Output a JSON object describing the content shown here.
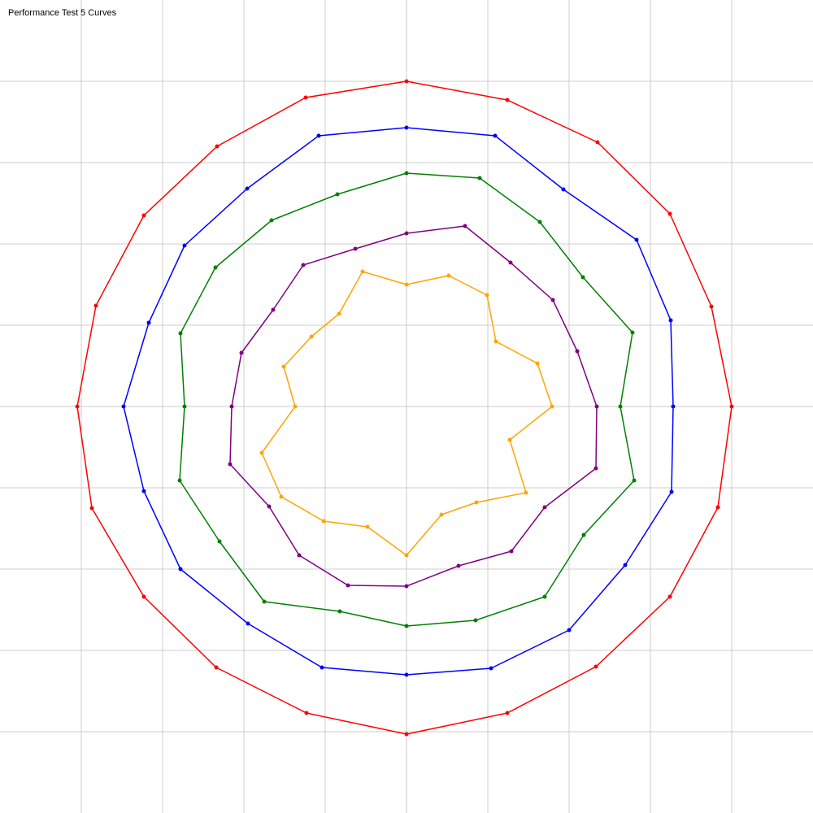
{
  "chart_data": {
    "type": "line",
    "title": "Performance Test 5 Curves",
    "grid": true,
    "xlim": [
      -5,
      5
    ],
    "ylim": [
      -5,
      5
    ],
    "series": [
      {
        "color": "#ff0000",
        "points": [
          [
            0,
            4
          ],
          [
            1.24,
            3.77
          ],
          [
            2.35,
            3.25
          ],
          [
            3.24,
            2.37
          ],
          [
            3.75,
            1.23
          ],
          [
            4,
            0
          ],
          [
            3.83,
            -1.24
          ],
          [
            3.24,
            -2.34
          ],
          [
            2.33,
            -3.2
          ],
          [
            1.24,
            -3.77
          ],
          [
            0,
            -4.03
          ],
          [
            -1.23,
            -3.77
          ],
          [
            -2.34,
            -3.21
          ],
          [
            -3.23,
            -2.34
          ],
          [
            -3.87,
            -1.25
          ],
          [
            -4.05,
            0
          ],
          [
            -3.82,
            1.24
          ],
          [
            -3.23,
            2.35
          ],
          [
            -2.33,
            3.2
          ],
          [
            -1.24,
            3.8
          ]
        ]
      },
      {
        "color": "#0000ff",
        "points": [
          [
            0,
            3.43
          ],
          [
            1.09,
            3.33
          ],
          [
            1.93,
            2.67
          ],
          [
            2.83,
            2.05
          ],
          [
            3.25,
            1.06
          ],
          [
            3.28,
            0
          ],
          [
            3.26,
            -1.05
          ],
          [
            2.69,
            -1.95
          ],
          [
            2.0,
            -2.75
          ],
          [
            1.04,
            -3.22
          ],
          [
            0,
            -3.3
          ],
          [
            -1.04,
            -3.21
          ],
          [
            -1.95,
            -2.67
          ],
          [
            -2.78,
            -2.0
          ],
          [
            -3.23,
            -1.04
          ],
          [
            -3.48,
            0
          ],
          [
            -3.17,
            1.03
          ],
          [
            -2.73,
            1.98
          ],
          [
            -1.96,
            2.68
          ],
          [
            -1.08,
            3.33
          ]
        ]
      },
      {
        "color": "#008000",
        "points": [
          [
            0,
            2.87
          ],
          [
            0.9,
            2.81
          ],
          [
            1.64,
            2.27
          ],
          [
            2.17,
            1.59
          ],
          [
            2.78,
            0.91
          ],
          [
            2.63,
            0
          ],
          [
            2.8,
            -0.91
          ],
          [
            2.18,
            -1.58
          ],
          [
            1.7,
            -2.34
          ],
          [
            0.85,
            -2.63
          ],
          [
            0,
            -2.7
          ],
          [
            -0.82,
            -2.52
          ],
          [
            -1.75,
            -2.4
          ],
          [
            -2.3,
            -1.66
          ],
          [
            -2.79,
            -0.91
          ],
          [
            -2.73,
            0
          ],
          [
            -2.78,
            0.9
          ],
          [
            -2.35,
            1.71
          ],
          [
            -1.66,
            2.29
          ],
          [
            -0.85,
            2.61
          ]
        ]
      },
      {
        "color": "#800080",
        "points": [
          [
            0,
            2.13
          ],
          [
            0.72,
            2.22
          ],
          [
            1.28,
            1.77
          ],
          [
            1.8,
            1.31
          ],
          [
            2.1,
            0.68
          ],
          [
            2.34,
            0
          ],
          [
            2.33,
            -0.76
          ],
          [
            1.7,
            -1.24
          ],
          [
            1.29,
            -1.78
          ],
          [
            0.64,
            -1.96
          ],
          [
            0,
            -2.21
          ],
          [
            -0.72,
            -2.2
          ],
          [
            -1.32,
            -1.83
          ],
          [
            -1.69,
            -1.23
          ],
          [
            -2.17,
            -0.71
          ],
          [
            -2.15,
            0
          ],
          [
            -2.03,
            0.66
          ],
          [
            -1.64,
            1.19
          ],
          [
            -1.27,
            1.74
          ],
          [
            -0.63,
            1.94
          ]
        ]
      },
      {
        "color": "#ffa500",
        "points": [
          [
            0,
            1.5
          ],
          [
            0.52,
            1.61
          ],
          [
            0.99,
            1.37
          ],
          [
            1.1,
            0.8
          ],
          [
            1.61,
            0.53
          ],
          [
            1.79,
            0
          ],
          [
            1.27,
            -0.41
          ],
          [
            1.47,
            -1.06
          ],
          [
            0.86,
            -1.18
          ],
          [
            0.43,
            -1.33
          ],
          [
            0,
            -1.83
          ],
          [
            -0.48,
            -1.48
          ],
          [
            -1.02,
            -1.41
          ],
          [
            -1.54,
            -1.11
          ],
          [
            -1.78,
            -0.57
          ],
          [
            -1.37,
            0
          ],
          [
            -1.51,
            0.49
          ],
          [
            -1.17,
            0.86
          ],
          [
            -0.83,
            1.14
          ],
          [
            -0.54,
            1.66
          ]
        ]
      }
    ]
  }
}
